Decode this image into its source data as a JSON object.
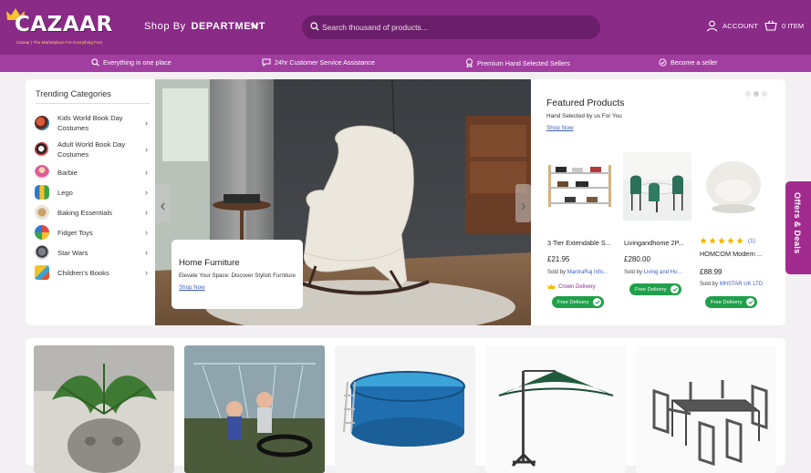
{
  "header": {
    "logo_text": "CAZAAR",
    "logo_tagline": "Cazaar | The Marketplace For Everything Fun!",
    "shop_by_label": "Shop By",
    "shop_by_strong": "DEPARTMENT",
    "search_placeholder": "Search thousand of products...",
    "account_label": "ACCOUNT",
    "cart_label": "0 ITEM"
  },
  "usp_bar": [
    {
      "icon": "search-icon",
      "text": "Everything in one place"
    },
    {
      "icon": "chat-icon",
      "text": "24hr Customer Service Assistance"
    },
    {
      "icon": "badge-icon",
      "text": "Premium Hand Selected Sellers"
    },
    {
      "icon": "check-circle-icon",
      "text": "Become a seller"
    }
  ],
  "trending": {
    "title": "Trending Categories",
    "items": [
      {
        "label": "Kids World Book Day Costumes"
      },
      {
        "label": "Adult World Book Day Costumes"
      },
      {
        "label": "Barbie"
      },
      {
        "label": "Lego"
      },
      {
        "label": "Baking Essentials"
      },
      {
        "label": "Fidget Toys"
      },
      {
        "label": "Star Wars"
      },
      {
        "label": "Children's Books"
      }
    ]
  },
  "hero": {
    "card_title": "Home Furniture",
    "card_subtitle": "Elevate Your Space: Discover Stylish Furniture",
    "card_link": "Shop Now"
  },
  "featured": {
    "title": "Featured Products",
    "subtitle": "Hand Selected by us For You",
    "link": "Shop Now",
    "products": [
      {
        "name": "3 Tier Extendable S...",
        "price": "£21.95",
        "sold_by": "Sold by",
        "seller": "MantraRaj Info...",
        "badge": "Crown Delivery",
        "free": "Free Delivery"
      },
      {
        "name": "Livingandhome 2P...",
        "price": "£280.00",
        "sold_by": "Sold by",
        "seller": "Living and Ho...",
        "free": "Free Delivery"
      },
      {
        "name": "HOMCOM Modern ...",
        "price": "£88.99",
        "sold_by": "Sold by",
        "seller": "MHSTAR UK LTD",
        "free": "Free Delivery",
        "rating": 5,
        "rating_count": "(1)"
      }
    ]
  },
  "offers_tab": "Offers & Deals",
  "colors": {
    "brand": "#8a2b88",
    "usp_bar": "#a23ea0",
    "free_delivery": "#1fa04a",
    "link": "#3b5fc0"
  }
}
